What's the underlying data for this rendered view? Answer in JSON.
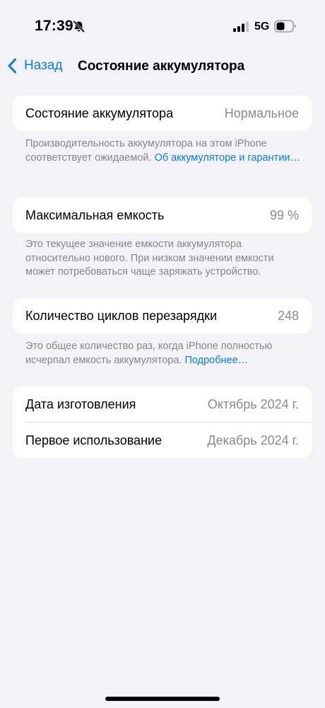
{
  "status_bar": {
    "time": "17:39",
    "network": "5G",
    "icons": [
      "bell-slash-icon",
      "signal-icon",
      "battery-icon"
    ]
  },
  "nav": {
    "back_label": "Назад",
    "title": "Состояние аккумулятора",
    "accent_color": "#0a7aff"
  },
  "battery_health": {
    "label": "Состояние аккумулятора",
    "value": "Нормальное",
    "footnote_text": "Производительность аккумулятора на этом iPhone соответствует ожидаемой.",
    "footnote_link": "Об аккумуляторе и гарантии…"
  },
  "max_capacity": {
    "label": "Максимальная емкость",
    "value": "99 %",
    "footnote_text": "Это текущее значение емкости аккумулятора относительно нового. При низком значении емкости может потребоваться чаще заряжать устройство."
  },
  "cycle_count": {
    "label": "Количество циклов перезарядки",
    "value": "248",
    "footnote_text": "Это общее количество раз, когда iPhone полностью исчерпал емкость аккумулятора.",
    "footnote_link": "Подробнее…"
  },
  "dates": {
    "manufacture_label": "Дата изготовления",
    "manufacture_value": "Октябрь 2024 г.",
    "first_use_label": "Первое использование",
    "first_use_value": "Декабрь 2024 г."
  }
}
